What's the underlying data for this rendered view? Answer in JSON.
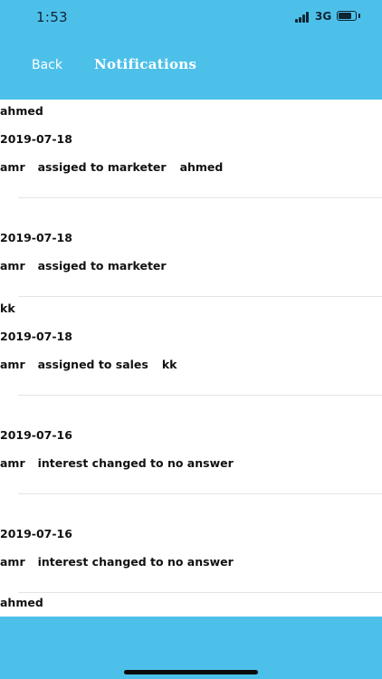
{
  "status_bar": {
    "time": "1:53",
    "network": "3G",
    "battery_level": 0.8
  },
  "nav": {
    "back_label": "Back",
    "title": "Notifications"
  },
  "notifications": [
    {
      "recipient": "ahmed",
      "date": "2019-07-18",
      "actor": "amr",
      "action": "assiged to marketer",
      "target": "ahmed"
    },
    {
      "recipient": "",
      "date": "2019-07-18",
      "actor": "amr",
      "action": "assiged to marketer",
      "target": ""
    },
    {
      "recipient": "kk",
      "date": "2019-07-18",
      "actor": "amr",
      "action": "assigned to sales",
      "target": "kk"
    },
    {
      "recipient": "",
      "date": "2019-07-16",
      "actor": "amr",
      "action": "interest changed to no answer",
      "target": ""
    },
    {
      "recipient": "",
      "date": "2019-07-16",
      "actor": "amr",
      "action": "interest changed to no answer",
      "target": ""
    }
  ],
  "partial_item": {
    "recipient": "ahmed"
  },
  "colors": {
    "brand": "#4dc0ea",
    "text": "#111111",
    "separator": "#e3e3e3"
  }
}
